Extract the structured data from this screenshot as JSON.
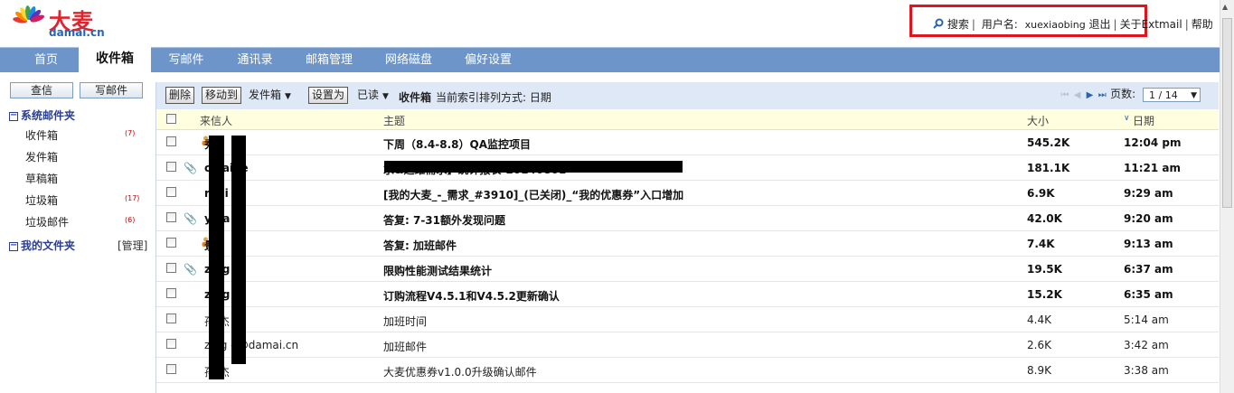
{
  "logo": {
    "cn": "大麦",
    "en": "damai.cn"
  },
  "userbar": {
    "search": "搜索",
    "username_label": "用户名:",
    "username": "xuexiaobing",
    "logout": "退出",
    "about": "关于",
    "extmail": "Extmail",
    "help": "帮助"
  },
  "nav": [
    {
      "label": "首页"
    },
    {
      "label": "收件箱"
    },
    {
      "label": "写邮件"
    },
    {
      "label": "通讯录"
    },
    {
      "label": "邮箱管理"
    },
    {
      "label": "网络磁盘"
    },
    {
      "label": "偏好设置"
    }
  ],
  "sidebar": {
    "query_btn": "查信",
    "compose_btn": "写邮件",
    "system_folders": "系统邮件夹",
    "folders": [
      {
        "name": "收件箱",
        "count": "(7)"
      },
      {
        "name": "发件箱",
        "count": ""
      },
      {
        "name": "草稿箱",
        "count": ""
      },
      {
        "name": "垃圾箱",
        "count": "(17)"
      },
      {
        "name": "垃圾邮件",
        "count": "(6)"
      }
    ],
    "my_folders": "我的文件夹",
    "manage": "[管理]"
  },
  "toolbar": {
    "delete": "删除",
    "move_to": "移动到",
    "move_target": "发件箱",
    "set_as": "设置为",
    "set_value": "已读",
    "folder_name": "收件箱",
    "sort_text": "当前索引排列方式: 日期"
  },
  "pager": {
    "label": "页数:",
    "value": "1 / 14"
  },
  "columns": {
    "from": "来信人",
    "subject": "主题",
    "size": "大小",
    "date": "日期"
  },
  "emails": [
    {
      "from": "秀",
      "subject": "下周（8.4-8.8）QA监控项目",
      "size": "545.2K",
      "date": "12:04 pm",
      "unread": true,
      "attach": false,
      "person": true
    },
    {
      "from": "c  hai  ie",
      "subject": "                                                  求&运维需求】统计报表-20140801",
      "size": "181.1K",
      "date": "11:21 am",
      "unread": true,
      "attach": true,
      "person": false
    },
    {
      "from": "r  mi   e",
      "subject": "[我的大麦_-_需求_#3910]_(已关闭)_“我的优惠券”入口增加",
      "size": "6.9K",
      "date": "9:29 am",
      "unread": true,
      "attach": false,
      "person": false
    },
    {
      "from": "y  jia  e",
      "subject": "答复: 7-31额外发现问题",
      "size": "42.0K",
      "date": "9:20 am",
      "unread": true,
      "attach": true,
      "person": false
    },
    {
      "from": "景",
      "subject": "答复: 加班邮件",
      "size": "7.4K",
      "date": "9:13 am",
      "unread": true,
      "attach": false,
      "person": true
    },
    {
      "from": "z  ng",
      "subject": "限购性能测试结果统计",
      "size": "19.5K",
      "date": "6:37 am",
      "unread": true,
      "attach": true,
      "person": false
    },
    {
      "from": "z  ng",
      "subject": "订购流程V4.5.1和V4.5.2更新确认",
      "size": "15.2K",
      "date": "6:35 am",
      "unread": true,
      "attach": false,
      "person": false
    },
    {
      "from": "孙  杰",
      "subject": "加班时间",
      "size": "4.4K",
      "date": "5:14 am",
      "unread": false,
      "attach": false,
      "person": false
    },
    {
      "from": "z  ng   g@damai.cn",
      "subject": "加班邮件",
      "size": "2.6K",
      "date": "3:42 am",
      "unread": false,
      "attach": false,
      "person": false
    },
    {
      "from": "孙  杰",
      "subject": "大麦优惠券v1.0.0升级确认邮件",
      "size": "8.9K",
      "date": "3:38 am",
      "unread": false,
      "attach": false,
      "person": false
    }
  ]
}
